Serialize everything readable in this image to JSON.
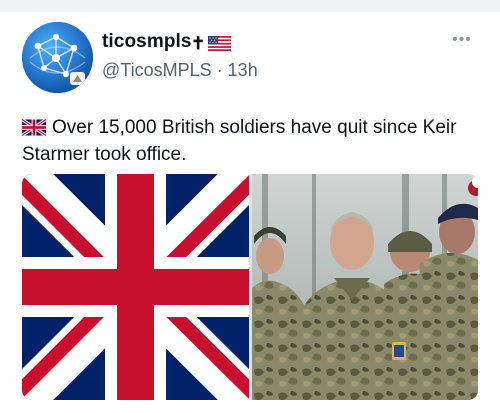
{
  "post": {
    "display_name": "ticosmpls",
    "name_badges": [
      "latin-cross-icon",
      "us-flag-icon"
    ],
    "handle": "@TicosMPLS",
    "separator": "·",
    "time_ago": "13h",
    "more_label": "•••",
    "text_flag": "uk-flag-icon",
    "text": "Over 15,000 British soldiers have quit since Keir Starmer took office.",
    "media": [
      {
        "kind": "image",
        "depicts": "union-jack-flag"
      },
      {
        "kind": "photo",
        "depicts": "soldiers-group-photo"
      }
    ]
  },
  "colors": {
    "union_blue": "#012169",
    "union_red": "#C8102E",
    "handle_gray": "#536471",
    "text": "#0f1419"
  },
  "icons": {
    "cross": "✝"
  }
}
